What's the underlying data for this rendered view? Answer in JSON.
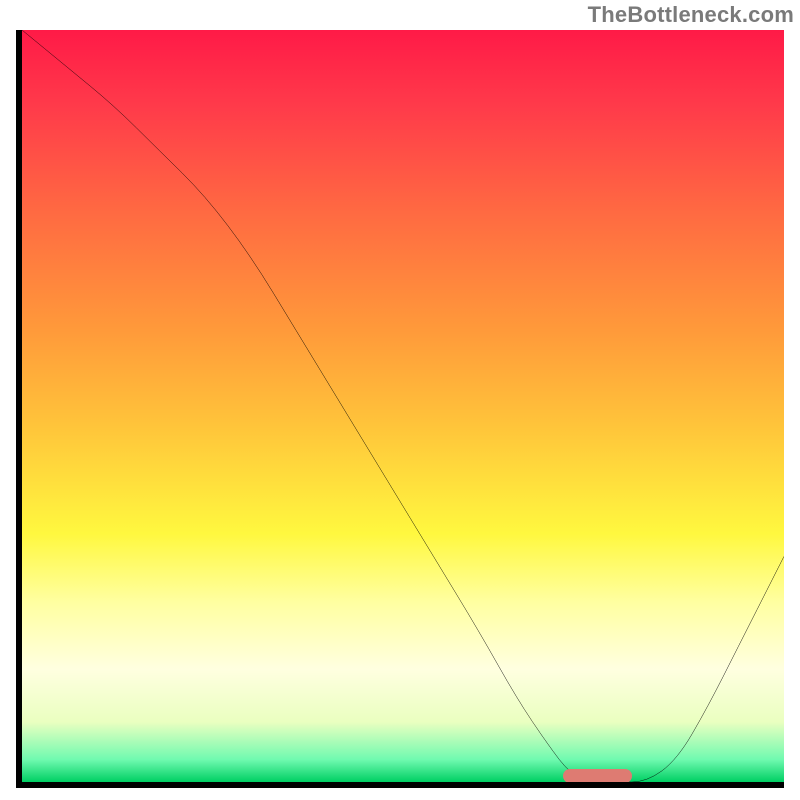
{
  "attribution": "TheBottleneck.com",
  "colors": {
    "gradient_top": "#ff1a47",
    "gradient_mid": "#ffe83a",
    "gradient_bottom": "#00cf63",
    "curve": "#000000",
    "marker": "#de7b72",
    "axis": "#000000"
  },
  "chart_data": {
    "type": "line",
    "title": "",
    "xlabel": "",
    "ylabel": "",
    "xlim": [
      0,
      100
    ],
    "ylim": [
      0,
      100
    ],
    "x": [
      0,
      6,
      12,
      18,
      24,
      30,
      36,
      42,
      48,
      54,
      60,
      65,
      69,
      72,
      75,
      78,
      82,
      86,
      90,
      94,
      98,
      100
    ],
    "y": [
      100,
      95,
      90,
      84,
      78,
      70,
      60,
      50,
      40,
      30,
      20,
      11,
      5,
      1,
      0,
      0,
      0,
      3,
      10,
      18,
      26,
      30
    ],
    "marker": {
      "x_start": 71,
      "x_end": 80,
      "y": 0
    },
    "notes": "Background is a red→yellow→green vertical gradient. Curve shows bottleneck: 0 = best (green), 100 = worst (red). Minimum plateau ≈ x 72–80."
  }
}
